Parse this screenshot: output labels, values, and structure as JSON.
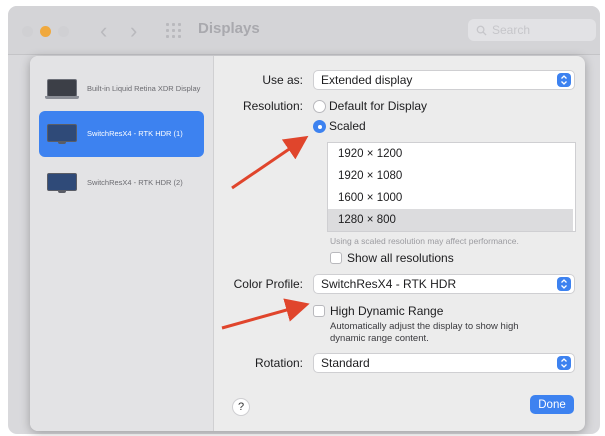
{
  "window": {
    "title": "Displays",
    "search_placeholder": "Search"
  },
  "sidebar": {
    "items": [
      {
        "label": "Built-in Liquid Retina XDR Display",
        "selected": false
      },
      {
        "label": "SwitchResX4 - RTK HDR (1)",
        "selected": true
      },
      {
        "label": "SwitchResX4 - RTK HDR (2)",
        "selected": false
      }
    ]
  },
  "settings": {
    "use_as_label": "Use as:",
    "use_as_value": "Extended display",
    "resolution_label": "Resolution:",
    "resolution_default": "Default for Display",
    "resolution_scaled": "Scaled",
    "resolutions": [
      "1920 × 1200",
      "1920 × 1080",
      "1600 × 1000",
      "1280 × 800"
    ],
    "selected_resolution": "1280 × 800",
    "scaled_hint": "Using a scaled resolution may affect performance.",
    "show_all_label": "Show all resolutions",
    "color_profile_label": "Color Profile:",
    "color_profile_value": "SwitchResX4 - RTK HDR",
    "hdr_label": "High Dynamic Range",
    "hdr_desc_1": "Automatically adjust the display to show high",
    "hdr_desc_2": "dynamic range content.",
    "rotation_label": "Rotation:",
    "rotation_value": "Standard"
  },
  "footer": {
    "help_label": "?",
    "done_label": "Done"
  },
  "colors": {
    "accent": "#3d82f0",
    "arrow": "#e0452c"
  }
}
